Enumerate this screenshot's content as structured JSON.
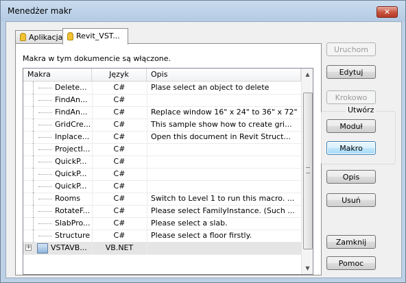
{
  "window": {
    "title": "Menedżer makr",
    "close_glyph": "✕"
  },
  "tabs": [
    {
      "label": "Aplikacja",
      "icon": "lightbulb-icon"
    },
    {
      "label": "Revit_VST...",
      "icon": "lightbulb-icon"
    }
  ],
  "status_text": "Makra w tym dokumencie są włączone.",
  "grid": {
    "columns": [
      "Makra",
      "Język",
      "Opis"
    ],
    "rows": [
      {
        "name": "Delete...",
        "lang": "C#",
        "desc": "Plase select an object to delete"
      },
      {
        "name": "FindAn...",
        "lang": "C#",
        "desc": ""
      },
      {
        "name": "FindAn...",
        "lang": "C#",
        "desc": "Replace window 16\" x 24\" to 36\" x 72\""
      },
      {
        "name": "GridCre...",
        "lang": "C#",
        "desc": "This sample show how to create gri..."
      },
      {
        "name": "Inplace...",
        "lang": "C#",
        "desc": "Open this document in Revit Struct..."
      },
      {
        "name": "ProjectI...",
        "lang": "C#",
        "desc": ""
      },
      {
        "name": "QuickP...",
        "lang": "C#",
        "desc": ""
      },
      {
        "name": "QuickP...",
        "lang": "C#",
        "desc": ""
      },
      {
        "name": "QuickP...",
        "lang": "C#",
        "desc": ""
      },
      {
        "name": "Rooms",
        "lang": "C#",
        "desc": "Switch to Level 1 to run this macro. ..."
      },
      {
        "name": "RotateF...",
        "lang": "C#",
        "desc": "Please select FamilyInstance. (Such ..."
      },
      {
        "name": "SlabPro...",
        "lang": "C#",
        "desc": "Please select a slab."
      },
      {
        "name": "Structure",
        "lang": "C#",
        "desc": "Please select a floor firstly."
      }
    ],
    "module_row": {
      "expand": "+",
      "name": "VSTAVB...",
      "lang": "VB.NET",
      "desc": ""
    }
  },
  "buttons": {
    "run": "Uruchom",
    "edit": "Edytuj",
    "step": "Krokowo",
    "create_group": "Utwórz",
    "module": "Moduł",
    "macro": "Makro",
    "description": "Opis",
    "delete": "Usuń",
    "close": "Zamknij",
    "help": "Pomoc"
  },
  "scroll": {
    "up": "▲",
    "down": "▼"
  }
}
